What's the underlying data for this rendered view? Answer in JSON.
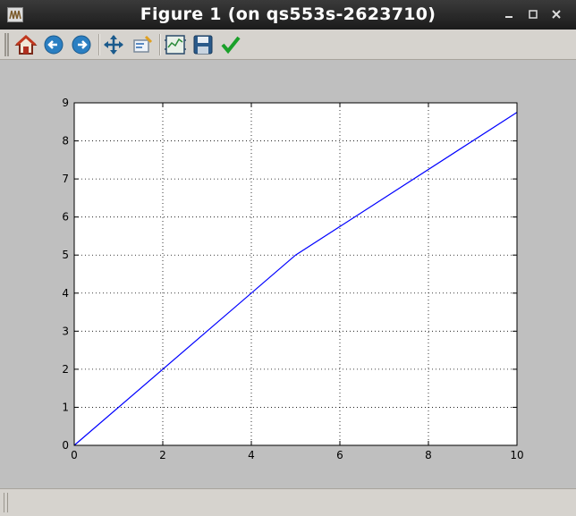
{
  "window": {
    "title": "Figure 1 (on qs553s-2623710)",
    "buttons": {
      "minimize": "–",
      "maximize": "☐",
      "close": "×"
    }
  },
  "toolbar": {
    "items": [
      {
        "name": "home",
        "icon": "home-icon"
      },
      {
        "name": "back",
        "icon": "back-arrow-icon"
      },
      {
        "name": "forward",
        "icon": "forward-arrow-icon"
      },
      {
        "name": "pan",
        "icon": "pan-arrows-icon"
      },
      {
        "name": "zoom",
        "icon": "zoom-rect-icon"
      },
      {
        "name": "subplots",
        "icon": "subplots-config-icon"
      },
      {
        "name": "save",
        "icon": "floppy-save-icon"
      },
      {
        "name": "edit",
        "icon": "checkmark-icon"
      }
    ]
  },
  "chart_data": {
    "type": "line",
    "title": "",
    "xlabel": "",
    "ylabel": "",
    "xlim": [
      0,
      10
    ],
    "ylim": [
      0,
      9
    ],
    "xticks": [
      0,
      2,
      4,
      6,
      8,
      10
    ],
    "yticks": [
      0,
      1,
      2,
      3,
      4,
      5,
      6,
      7,
      8,
      9
    ],
    "grid": true,
    "series": [
      {
        "x": [
          0,
          5,
          10
        ],
        "y": [
          0,
          5,
          8.75
        ],
        "color": "#0000ff"
      }
    ]
  }
}
